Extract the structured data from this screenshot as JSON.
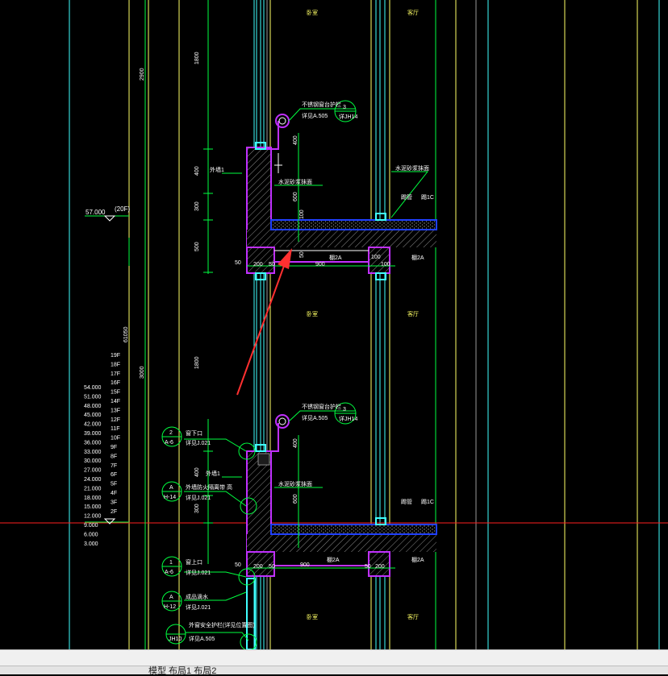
{
  "colors": {
    "background": "#000000",
    "hatch": "#8a8a8a",
    "dim": "#00ff40",
    "text": "#ffff66",
    "purple": "#c030ff",
    "cyan": "#40ffff",
    "blue": "#2040ff",
    "red": "#ff2020",
    "arrow": "#ff3030"
  },
  "labels": {
    "room_top_left": "卧室",
    "room_top_right": "客厅",
    "room_mid_left": "卧室",
    "room_mid_right": "客厅",
    "room_bot_left": "卧室",
    "room_bot_right": "客厅",
    "detail1": "不锈钢窗台护栏",
    "detail1_num": "3",
    "detail1_ref": "详JH14",
    "detail1_page": "详见A.505",
    "detail2": "不锈钢窗台护栏",
    "detail2_num": "3",
    "detail2_ref": "详JH14",
    "detail2_page": "详见A.505",
    "wall1": "外墙1",
    "wall2": "外墙1",
    "mortar1": "水泥砂浆抹面",
    "mortar2": "水泥砂浆抹面",
    "mortar3": "水泥砂浆抹面",
    "mortar4": "水泥砂浆抹面",
    "tube1": "踢管",
    "tube1_b": "踢1C",
    "tube2": "踢管",
    "tube2_b": "踢1C",
    "ceiling1": "棚2A",
    "ceiling2": "棚2A",
    "ceiling3": "棚2A",
    "ceiling4": "棚2A",
    "bubble_a_num": "2",
    "bubble_a_ref": "A-6",
    "bubble_a_text": "窗下口",
    "bubble_a_page": "详见J.021",
    "bubble_b_num": "A",
    "bubble_b_ref": "H-14",
    "bubble_b_text": "外墙防火隔离带  高",
    "bubble_b_page": "详见J.021",
    "bubble_c_num": "1",
    "bubble_c_ref": "A-6",
    "bubble_c_text": "窗上口",
    "bubble_c_page": "详见J.021",
    "bubble_d_num": "A",
    "bubble_d_ref": "H-12",
    "bubble_d_text": "成品滴水",
    "bubble_d_page": "详见J.021",
    "bubble_e_ref": "JH10",
    "bubble_e_text": "外窗安全护栏(详见位置图)",
    "bubble_e_page": "详见A.505",
    "level_top": "57.000",
    "level_top_floor": "(20F)",
    "dim_2900": "2900",
    "dim_1800": "1800",
    "dim_400": "400",
    "dim_300": "300",
    "dim_500": "500",
    "dim_50": "50",
    "dim_200": "200",
    "dim_900": "900",
    "dim_100": "100",
    "dim_600": "600",
    "dim_61050": "61050",
    "dim_3000": "3000",
    "dim_1800b": "1800",
    "dim_400b": "400",
    "dim_300b": "300"
  },
  "floors": [
    "19F",
    "18F",
    "17F",
    "16F",
    "15F",
    "14F",
    "13F",
    "12F",
    "11F",
    "10F",
    "9F",
    "8F",
    "7F",
    "6F",
    "5F",
    "4F",
    "3F",
    "2F"
  ],
  "elevations": [
    "54.000",
    "51.000",
    "48.000",
    "45.000",
    "42.000",
    "39.000",
    "36.000",
    "33.000",
    "30.000",
    "27.000",
    "24.000",
    "21.000",
    "18.000",
    "15.000",
    "12.000",
    "9.000",
    "6.000",
    "3.000"
  ],
  "command_text": "模型  布局1  布局2"
}
